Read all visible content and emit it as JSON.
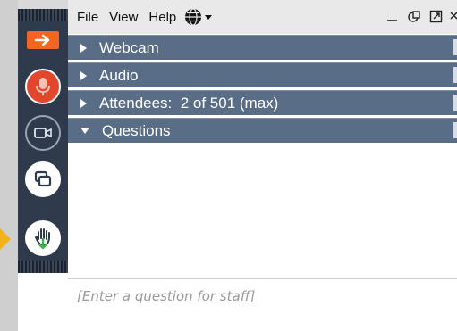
{
  "menu": {
    "file": "File",
    "view": "View",
    "help": "Help",
    "language_icon": "globe-icon"
  },
  "window_controls": [
    "minimize-icon",
    "popout-icon",
    "expand-icon",
    "close-icon"
  ],
  "toolbar": {
    "buttons": [
      "exit-arrow-icon",
      "microphone-icon",
      "webcam-icon",
      "screen-share-icon",
      "raise-hand-icon"
    ],
    "colors": {
      "toolbar_bg": "#2f3a4c",
      "exit": "#f26522",
      "mic_active": "#e2472d",
      "pointer": "#f3b21b"
    }
  },
  "sections": {
    "webcam": "Webcam",
    "audio": "Audio",
    "attendees": "Attendees:  2 of 501 (max)",
    "questions": "Questions"
  },
  "section_color": "#5a6d86",
  "questions": {
    "placeholder": "[Enter a question for staff]"
  }
}
